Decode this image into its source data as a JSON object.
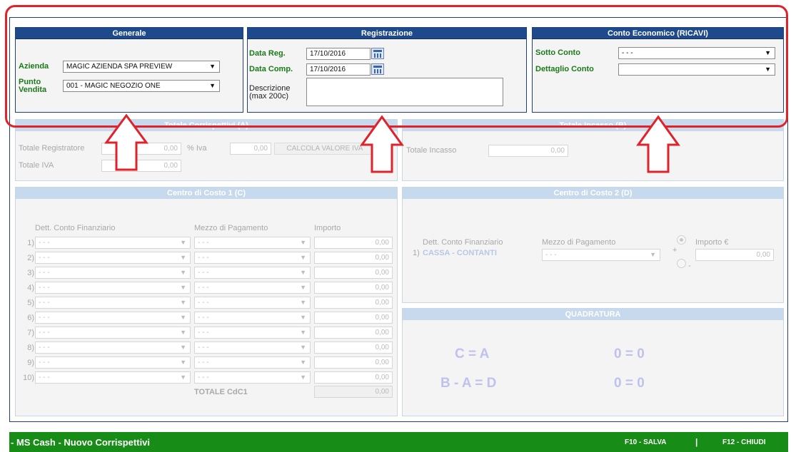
{
  "generale": {
    "title": "Generale",
    "azienda_label": "Azienda",
    "azienda_value": "MAGIC AZIENDA SPA PREVIEW",
    "punto_label_1": "Punto",
    "punto_label_2": "Vendita",
    "punto_value": "001 - MAGIC NEGOZIO ONE"
  },
  "registrazione": {
    "title": "Registrazione",
    "data_reg_label": "Data Reg.",
    "data_reg_value": "17/10/2016",
    "data_comp_label": "Data Comp.",
    "data_comp_value": "17/10/2016",
    "descr_label_1": "Descrizione",
    "descr_label_2": "(max 200c)",
    "descr_value": ""
  },
  "conto": {
    "title": "Conto Economico (RICAVI)",
    "sotto_label": "Sotto Conto",
    "sotto_value": "- - -",
    "dettaglio_label": "Dettaglio Conto",
    "dettaglio_value": ""
  },
  "totale_a": {
    "title": "Totale Corrispettivi (A)",
    "reg_label": "Totale Registratore",
    "reg_value": "0,00",
    "iva_pct_label": "% Iva",
    "iva_pct_value": "0,00",
    "calc_button": "CALCOLA VALORE IVA",
    "iva_label": "Totale IVA",
    "iva_value": "0,00"
  },
  "totale_b": {
    "title": "Totale Incasso (B)",
    "incasso_label": "Totale Incasso",
    "incasso_value": "0,00"
  },
  "cdc1": {
    "title": "Centro di Costo 1 (C)",
    "col_conto": "Dett. Conto Finanziario",
    "col_mezzo": "Mezzo di Pagamento",
    "col_importo": "Importo",
    "rows": [
      {
        "n": "1)",
        "conto": "- - -",
        "mezzo": "- - -",
        "importo": "0,00"
      },
      {
        "n": "2)",
        "conto": "- - -",
        "mezzo": "- - -",
        "importo": "0,00"
      },
      {
        "n": "3)",
        "conto": "- - -",
        "mezzo": "- - -",
        "importo": "0,00"
      },
      {
        "n": "4)",
        "conto": "- - -",
        "mezzo": "- - -",
        "importo": "0,00"
      },
      {
        "n": "5)",
        "conto": "- - -",
        "mezzo": "- - -",
        "importo": "0,00"
      },
      {
        "n": "6)",
        "conto": "- - -",
        "mezzo": "- - -",
        "importo": "0,00"
      },
      {
        "n": "7)",
        "conto": "- - -",
        "mezzo": "- - -",
        "importo": "0,00"
      },
      {
        "n": "8)",
        "conto": "- - -",
        "mezzo": "- - -",
        "importo": "0,00"
      },
      {
        "n": "9)",
        "conto": "- - -",
        "mezzo": "- - -",
        "importo": "0,00"
      },
      {
        "n": "10)",
        "conto": "- - -",
        "mezzo": "- - -",
        "importo": "0,00"
      }
    ],
    "total_label": "TOTALE CdC1",
    "total_value": "0,00"
  },
  "cdc2": {
    "title": "Centro di Costo 2 (D)",
    "col_conto": "Dett. Conto Finanziario",
    "col_mezzo": "Mezzo di Pagamento",
    "col_importo": "Importo €",
    "row_n": "1)",
    "row_conto": "CASSA - CONTANTI",
    "row_mezzo": "- - -",
    "row_importo": "0,00",
    "plus": "+",
    "minus": "-"
  },
  "quadratura": {
    "title": "QUADRATURA",
    "eq1_left": "C = A",
    "eq1_right": "0 = 0",
    "eq2_left": "B - A = D",
    "eq2_right": "0 = 0"
  },
  "footer": {
    "title": "- MS Cash - Nuovo Corrispettivi",
    "save": "F10 - SALVA",
    "sep": "|",
    "close": "F12 - CHIUDI"
  },
  "colors": {
    "header_active": "#1e4a8c",
    "header_faded": "#c7d9ec",
    "label_green": "#1a7a1a",
    "highlight_red": "#e0222b",
    "footer_green": "#178c17",
    "quadratura_text": "#bfc2ec"
  },
  "icons": {
    "calendar": "calendar-icon",
    "arrow": "up-arrow-annotation",
    "dropdown": "chevron-down-icon"
  }
}
